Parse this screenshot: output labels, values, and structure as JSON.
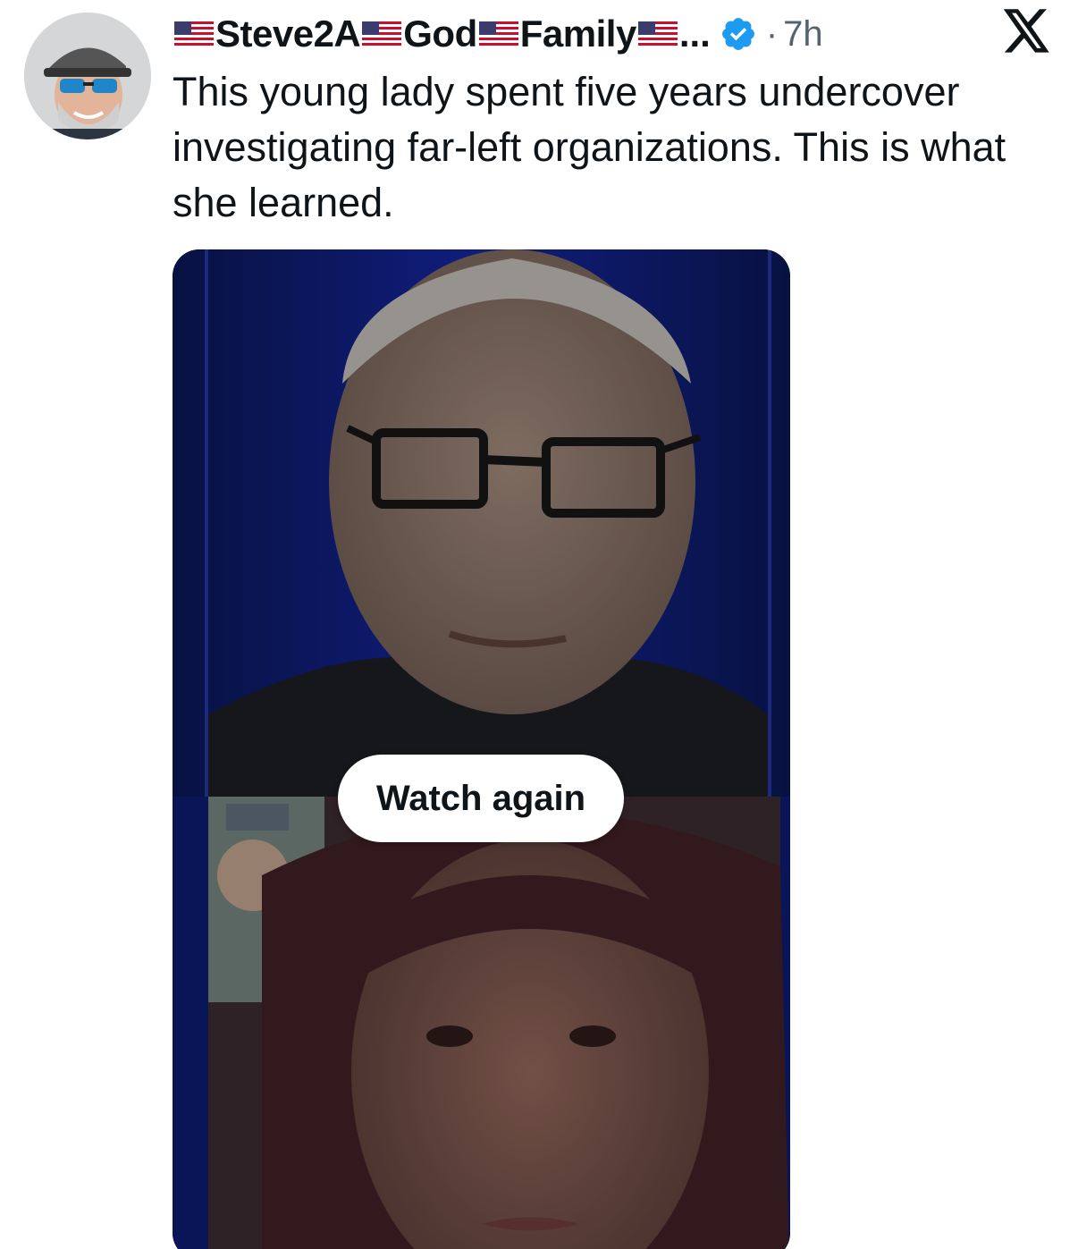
{
  "tweet": {
    "author": {
      "name_parts": [
        "Steve2A",
        "God",
        "Family"
      ],
      "ellipsis": "...",
      "verified": true,
      "avatar_icon": "user-avatar"
    },
    "separator": "·",
    "time": "7h",
    "text": "This young lady spent five years undercover investigating far-left organizations. This is what she learned.",
    "media": {
      "type": "video",
      "button_label": "Watch again"
    }
  },
  "brand": {
    "logo_icon": "x-logo-icon",
    "verified_color": "#1d9bf0",
    "text_color": "#0f1419",
    "muted_color": "#536471"
  }
}
